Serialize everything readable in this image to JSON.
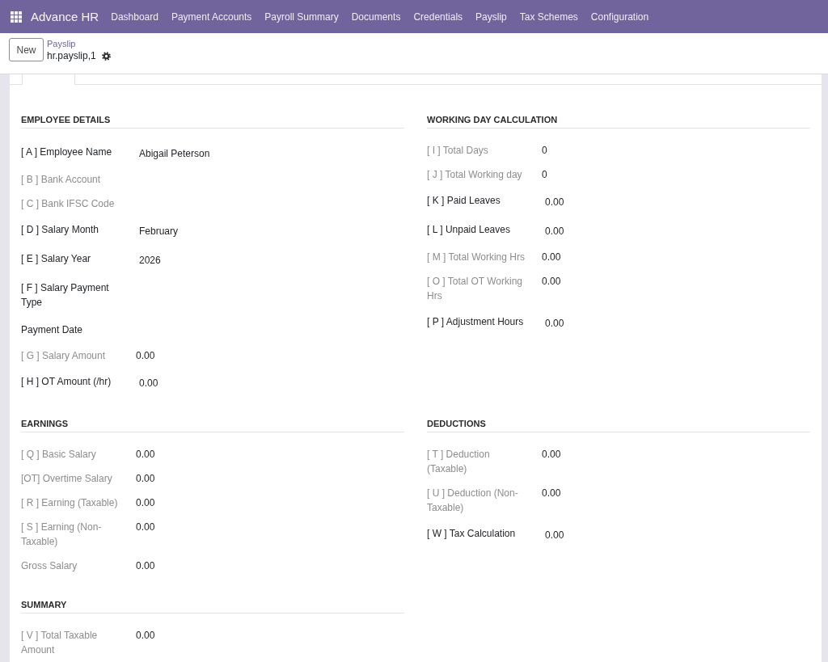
{
  "navbar": {
    "app_name": "Advance HR",
    "menu": [
      "Dashboard",
      "Payment Accounts",
      "Payroll Summary",
      "Documents",
      "Credentials",
      "Payslip",
      "Tax Schemes",
      "Configuration"
    ]
  },
  "control_panel": {
    "new_button": "New",
    "breadcrumb": "Payslip",
    "record_name": "hr.payslip,1"
  },
  "tabs": [
    {
      "selected": true
    }
  ],
  "sections": [
    {
      "title": "EMPLOYEE DETAILS",
      "fields": [
        {
          "label": "[ A ] Employee Name",
          "value": "Abigail Peterson",
          "readonly": false
        },
        {
          "label": "[ B ] Bank Account",
          "readonly": true
        },
        {
          "label": "[ C ] Bank IFSC Code",
          "readonly": true
        },
        {
          "label": "[ D ] Salary Month",
          "value": "February",
          "readonly": false
        },
        {
          "label": "[ E ] Salary Year",
          "value": "2026",
          "readonly": false
        },
        {
          "label": "[ F ] Salary Payment Type",
          "readonly": false
        },
        {
          "label": "Payment Date",
          "readonly": false
        },
        {
          "label": "[ G ] Salary Amount",
          "value": "0.00",
          "readonly": true
        },
        {
          "label": "[ H ] OT Amount (/hr)",
          "value": "0.00",
          "readonly": false
        }
      ]
    },
    {
      "title": "WORKING DAY CALCULATION",
      "fields": [
        {
          "label": "[ I ] Total Days",
          "value": "0",
          "readonly": true
        },
        {
          "label": "[ J ] Total Working day",
          "value": "0",
          "readonly": true
        },
        {
          "label": "[ K ] Paid Leaves",
          "value": "0.00",
          "readonly": false
        },
        {
          "label": "[ L ] Unpaid Leaves",
          "value": "0.00",
          "readonly": false
        },
        {
          "label": "[ M ] Total Working Hrs",
          "value": "0.00",
          "readonly": true
        },
        {
          "label": "[ O ] Total OT Working Hrs",
          "value": "0.00",
          "readonly": true
        },
        {
          "label": "[ P ] Adjustment Hours",
          "value": "0.00",
          "readonly": false
        }
      ]
    },
    {
      "title": "EARNINGS",
      "fields": [
        {
          "label": "[ Q ] Basic Salary",
          "value": "0.00",
          "readonly": true
        },
        {
          "label": "[OT] Overtime Salary",
          "value": "0.00",
          "readonly": true
        },
        {
          "label": "[ R ] Earning (Taxable)",
          "value": "0.00",
          "readonly": true
        },
        {
          "label": "[ S ] Earning (Non-Taxable)",
          "value": "0.00",
          "readonly": true
        },
        {
          "label": "Gross Salary",
          "value": "0.00",
          "readonly": true
        }
      ]
    },
    {
      "title": "DEDUCTIONS",
      "fields": [
        {
          "label": "[ T ] Deduction (Taxable)",
          "value": "0.00",
          "readonly": true
        },
        {
          "label": "[ U ] Deduction (Non-Taxable)",
          "value": "0.00",
          "readonly": true
        },
        {
          "label": "[ W ] Tax Calculation",
          "value": "0.00",
          "readonly": false
        }
      ]
    },
    {
      "title": "SUMMARY",
      "fields": [
        {
          "label": "[ V ] Total Taxable Amount",
          "value": "0.00",
          "readonly": true
        }
      ]
    }
  ]
}
